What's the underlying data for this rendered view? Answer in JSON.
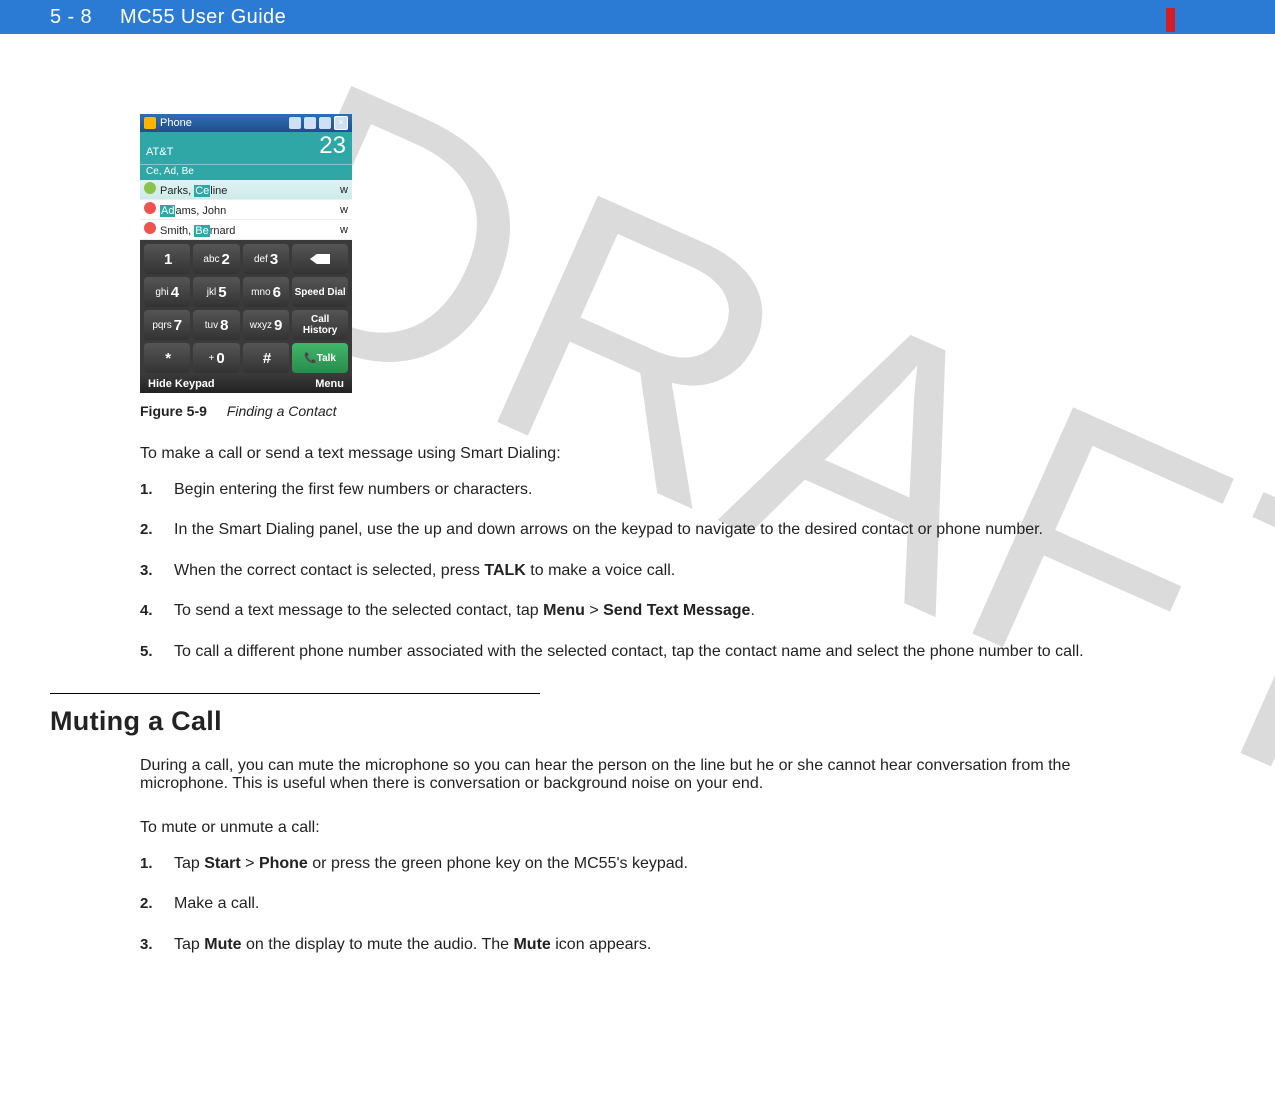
{
  "header": {
    "page": "5 - 8",
    "title": "MC55 User Guide"
  },
  "watermark": "DRAFT",
  "phone": {
    "titlebar": "Phone",
    "carrier": "AT&T",
    "dialed_number": "23",
    "filter_text": "Ce, Ad, Be",
    "contacts": [
      {
        "pre": "Parks, ",
        "hl": "Ce",
        "post": "line",
        "meta": "w"
      },
      {
        "pre": "",
        "hl": "Ad",
        "post": "ams, John",
        "meta": "w"
      },
      {
        "pre": "Smith, ",
        "hl": "Be",
        "post": "rnard",
        "meta": "w"
      }
    ],
    "keys": {
      "row1": [
        {
          "s": "",
          "n": "1"
        },
        {
          "s": "abc",
          "n": "2"
        },
        {
          "s": "def",
          "n": "3"
        }
      ],
      "row2": [
        {
          "s": "ghi",
          "n": "4"
        },
        {
          "s": "jkl",
          "n": "5"
        },
        {
          "s": "mno",
          "n": "6"
        }
      ],
      "row3": [
        {
          "s": "pqrs",
          "n": "7"
        },
        {
          "s": "tuv",
          "n": "8"
        },
        {
          "s": "wxyz",
          "n": "9"
        }
      ],
      "row4": [
        {
          "s": "",
          "n": "*"
        },
        {
          "s": "+",
          "n": "0"
        },
        {
          "s": "",
          "n": "#"
        }
      ],
      "side": [
        "←",
        "Speed Dial",
        "Call History",
        "Talk"
      ]
    },
    "softkeys": {
      "left": "Hide Keypad",
      "right": "Menu"
    }
  },
  "figure": {
    "label": "Figure 5-9",
    "title": "Finding a Contact"
  },
  "intro1": "To make a call or send a text message using Smart Dialing:",
  "list1": [
    {
      "n": "1.",
      "text": "Begin entering the first few numbers or characters."
    },
    {
      "n": "2.",
      "text": "In the Smart Dialing panel, use the up and down arrows on the keypad to navigate to the desired contact or phone number."
    },
    {
      "n": "3.",
      "pre": "When the correct contact is selected, press ",
      "b1": "TALK",
      "post": " to make a voice call."
    },
    {
      "n": "4.",
      "pre": "To send a text message to the selected contact, tap ",
      "b1": "Menu",
      "mid": " > ",
      "b2": "Send Text Message",
      "post": "."
    },
    {
      "n": "5.",
      "text": "To call a different phone number associated with the selected contact, tap the contact name and select the phone number to call."
    }
  ],
  "section2": "Muting a Call",
  "para2": "During a call, you can mute the microphone so you can hear the person on the line but he or she cannot hear conversation from the microphone. This is useful when there is conversation or background noise on your end.",
  "para3": "To mute or unmute a call:",
  "list2": [
    {
      "n": "1.",
      "pre": "Tap ",
      "b1": "Start",
      "mid": " > ",
      "b2": "Phone",
      "post": " or press the green phone key on the MC55's keypad."
    },
    {
      "n": "2.",
      "text": "Make a call."
    },
    {
      "n": "3.",
      "pre": "Tap ",
      "b1": "Mute",
      "mid": " on the display to mute the audio. The ",
      "b2": "Mute",
      "post": " icon appears."
    }
  ]
}
